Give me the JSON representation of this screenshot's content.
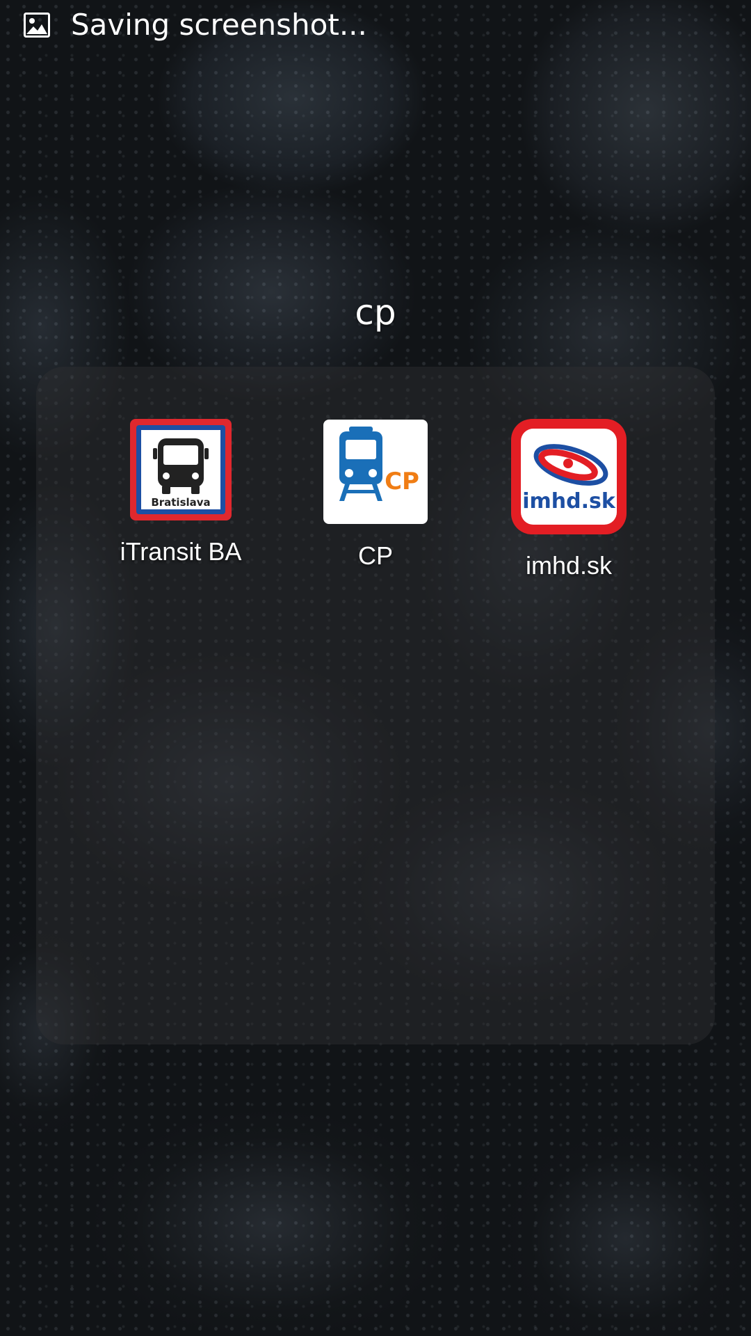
{
  "status_bar": {
    "notification_icon": "image-icon",
    "notification_text": "Saving screenshot..."
  },
  "folder": {
    "title": "cp",
    "apps": [
      {
        "label": "iTransit BA",
        "icon": "bus-icon",
        "icon_text": "Bratislava"
      },
      {
        "label": "CP",
        "icon": "train-icon",
        "icon_text": "CP"
      },
      {
        "label": "imhd.sk",
        "icon": "imhd-logo-icon",
        "icon_text": "imhd.sk"
      }
    ]
  },
  "colors": {
    "itransit_red": "#e0282e",
    "itransit_blue": "#1d4fa3",
    "cp_blue": "#1a6fb8",
    "cp_orange": "#f07d14",
    "imhd_red": "#e31e24"
  }
}
